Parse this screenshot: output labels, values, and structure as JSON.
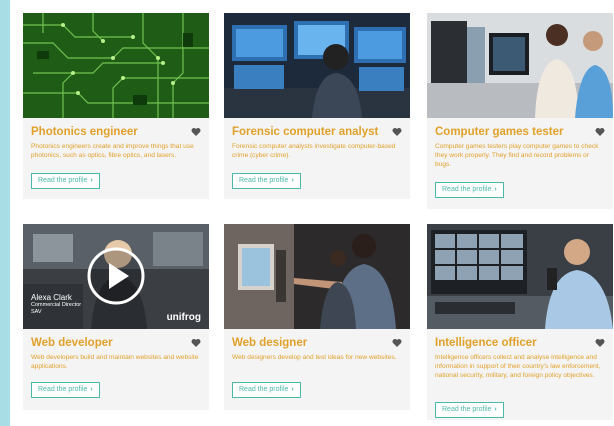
{
  "colors": {
    "title": "#e0a12a",
    "button": "#4cb9a8",
    "page_bg": "#a8dde6",
    "card_bg": "#f4f4f4"
  },
  "cards": [
    {
      "title": "Photonics engineer",
      "description": "Photonics engineers create and improve things that use photonics, such as optics, fibre optics, and lasers.",
      "button": "Read the profile",
      "image": "circuit-board-photo"
    },
    {
      "title": "Forensic computer analyst",
      "description": "Forensic computer analysts investigate computer-based crime (cyber crime).",
      "button": "Read the profile",
      "image": "analyst-monitors-photo"
    },
    {
      "title": "Computer games tester",
      "description": "Computer games testers play computer games to check they work properly. They find and record problems or bugs.",
      "button": "Read the profile",
      "image": "games-testers-photo"
    },
    {
      "title": "Web developer",
      "description": "Web developers build and maintain websites and website applications.",
      "button": "Read the profile",
      "image": "video-thumbnail",
      "video_caption_name": "Alexa Clark",
      "video_caption_role": "Commercial Director",
      "video_caption_company": "SAV",
      "video_brand": "unifrog"
    },
    {
      "title": "Web designer",
      "description": "Web designers develop and test ideas for new websites.",
      "button": "Read the profile",
      "image": "web-designers-photo"
    },
    {
      "title": "Intelligence officer",
      "description": "Intelligence officers collect and analyse intelligence and information in support of their country's law enforcement, national security, military, and foreign policy objectives.",
      "button": "Read the profile",
      "image": "intelligence-officer-photo"
    }
  ]
}
